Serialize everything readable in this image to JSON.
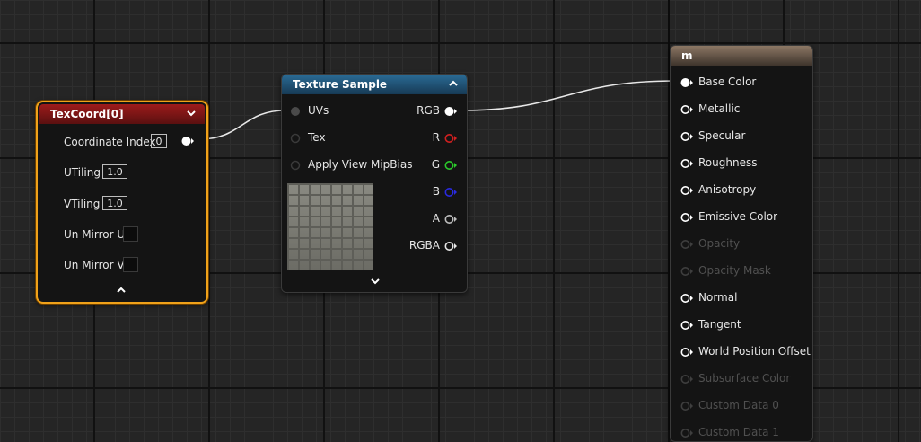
{
  "texcoord": {
    "title": "TexCoord[0]",
    "coordinate_index_label": "Coordinate Index",
    "coordinate_index_value": "0",
    "utiling_label": "UTiling",
    "utiling_value": "1.0",
    "vtiling_label": "VTiling",
    "vtiling_value": "1.0",
    "un_mirror_u_label": "Un Mirror U",
    "un_mirror_v_label": "Un Mirror V",
    "accent_color": "#f0a21a",
    "header_color": "#9e1b1b"
  },
  "texture_sample": {
    "title": "Texture Sample",
    "inputs": [
      "UVs",
      "Tex",
      "Apply View MipBias"
    ],
    "outputs": [
      "RGB",
      "R",
      "G",
      "B",
      "A",
      "RGBA"
    ],
    "header_color": "#2a6b95"
  },
  "material": {
    "title": "m",
    "pins": [
      {
        "label": "Base Color",
        "enabled": true
      },
      {
        "label": "Metallic",
        "enabled": true
      },
      {
        "label": "Specular",
        "enabled": true
      },
      {
        "label": "Roughness",
        "enabled": true
      },
      {
        "label": "Anisotropy",
        "enabled": true
      },
      {
        "label": "Emissive Color",
        "enabled": true
      },
      {
        "label": "Opacity",
        "enabled": false
      },
      {
        "label": "Opacity Mask",
        "enabled": false
      },
      {
        "label": "Normal",
        "enabled": true
      },
      {
        "label": "Tangent",
        "enabled": true
      },
      {
        "label": "World Position Offset",
        "enabled": true
      },
      {
        "label": "Subsurface Color",
        "enabled": false
      },
      {
        "label": "Custom Data 0",
        "enabled": false
      },
      {
        "label": "Custom Data 1",
        "enabled": false
      }
    ]
  },
  "colors": {
    "pin_r": "#d22020",
    "pin_g": "#2bc92b",
    "pin_b": "#2a2ae0",
    "pin_white": "#ffffff",
    "pin_gray": "#bdbdbd"
  },
  "icons": {
    "collapse": "chevron-down-icon",
    "expand": "chevron-up-icon",
    "pin": "exec-pin-icon"
  }
}
